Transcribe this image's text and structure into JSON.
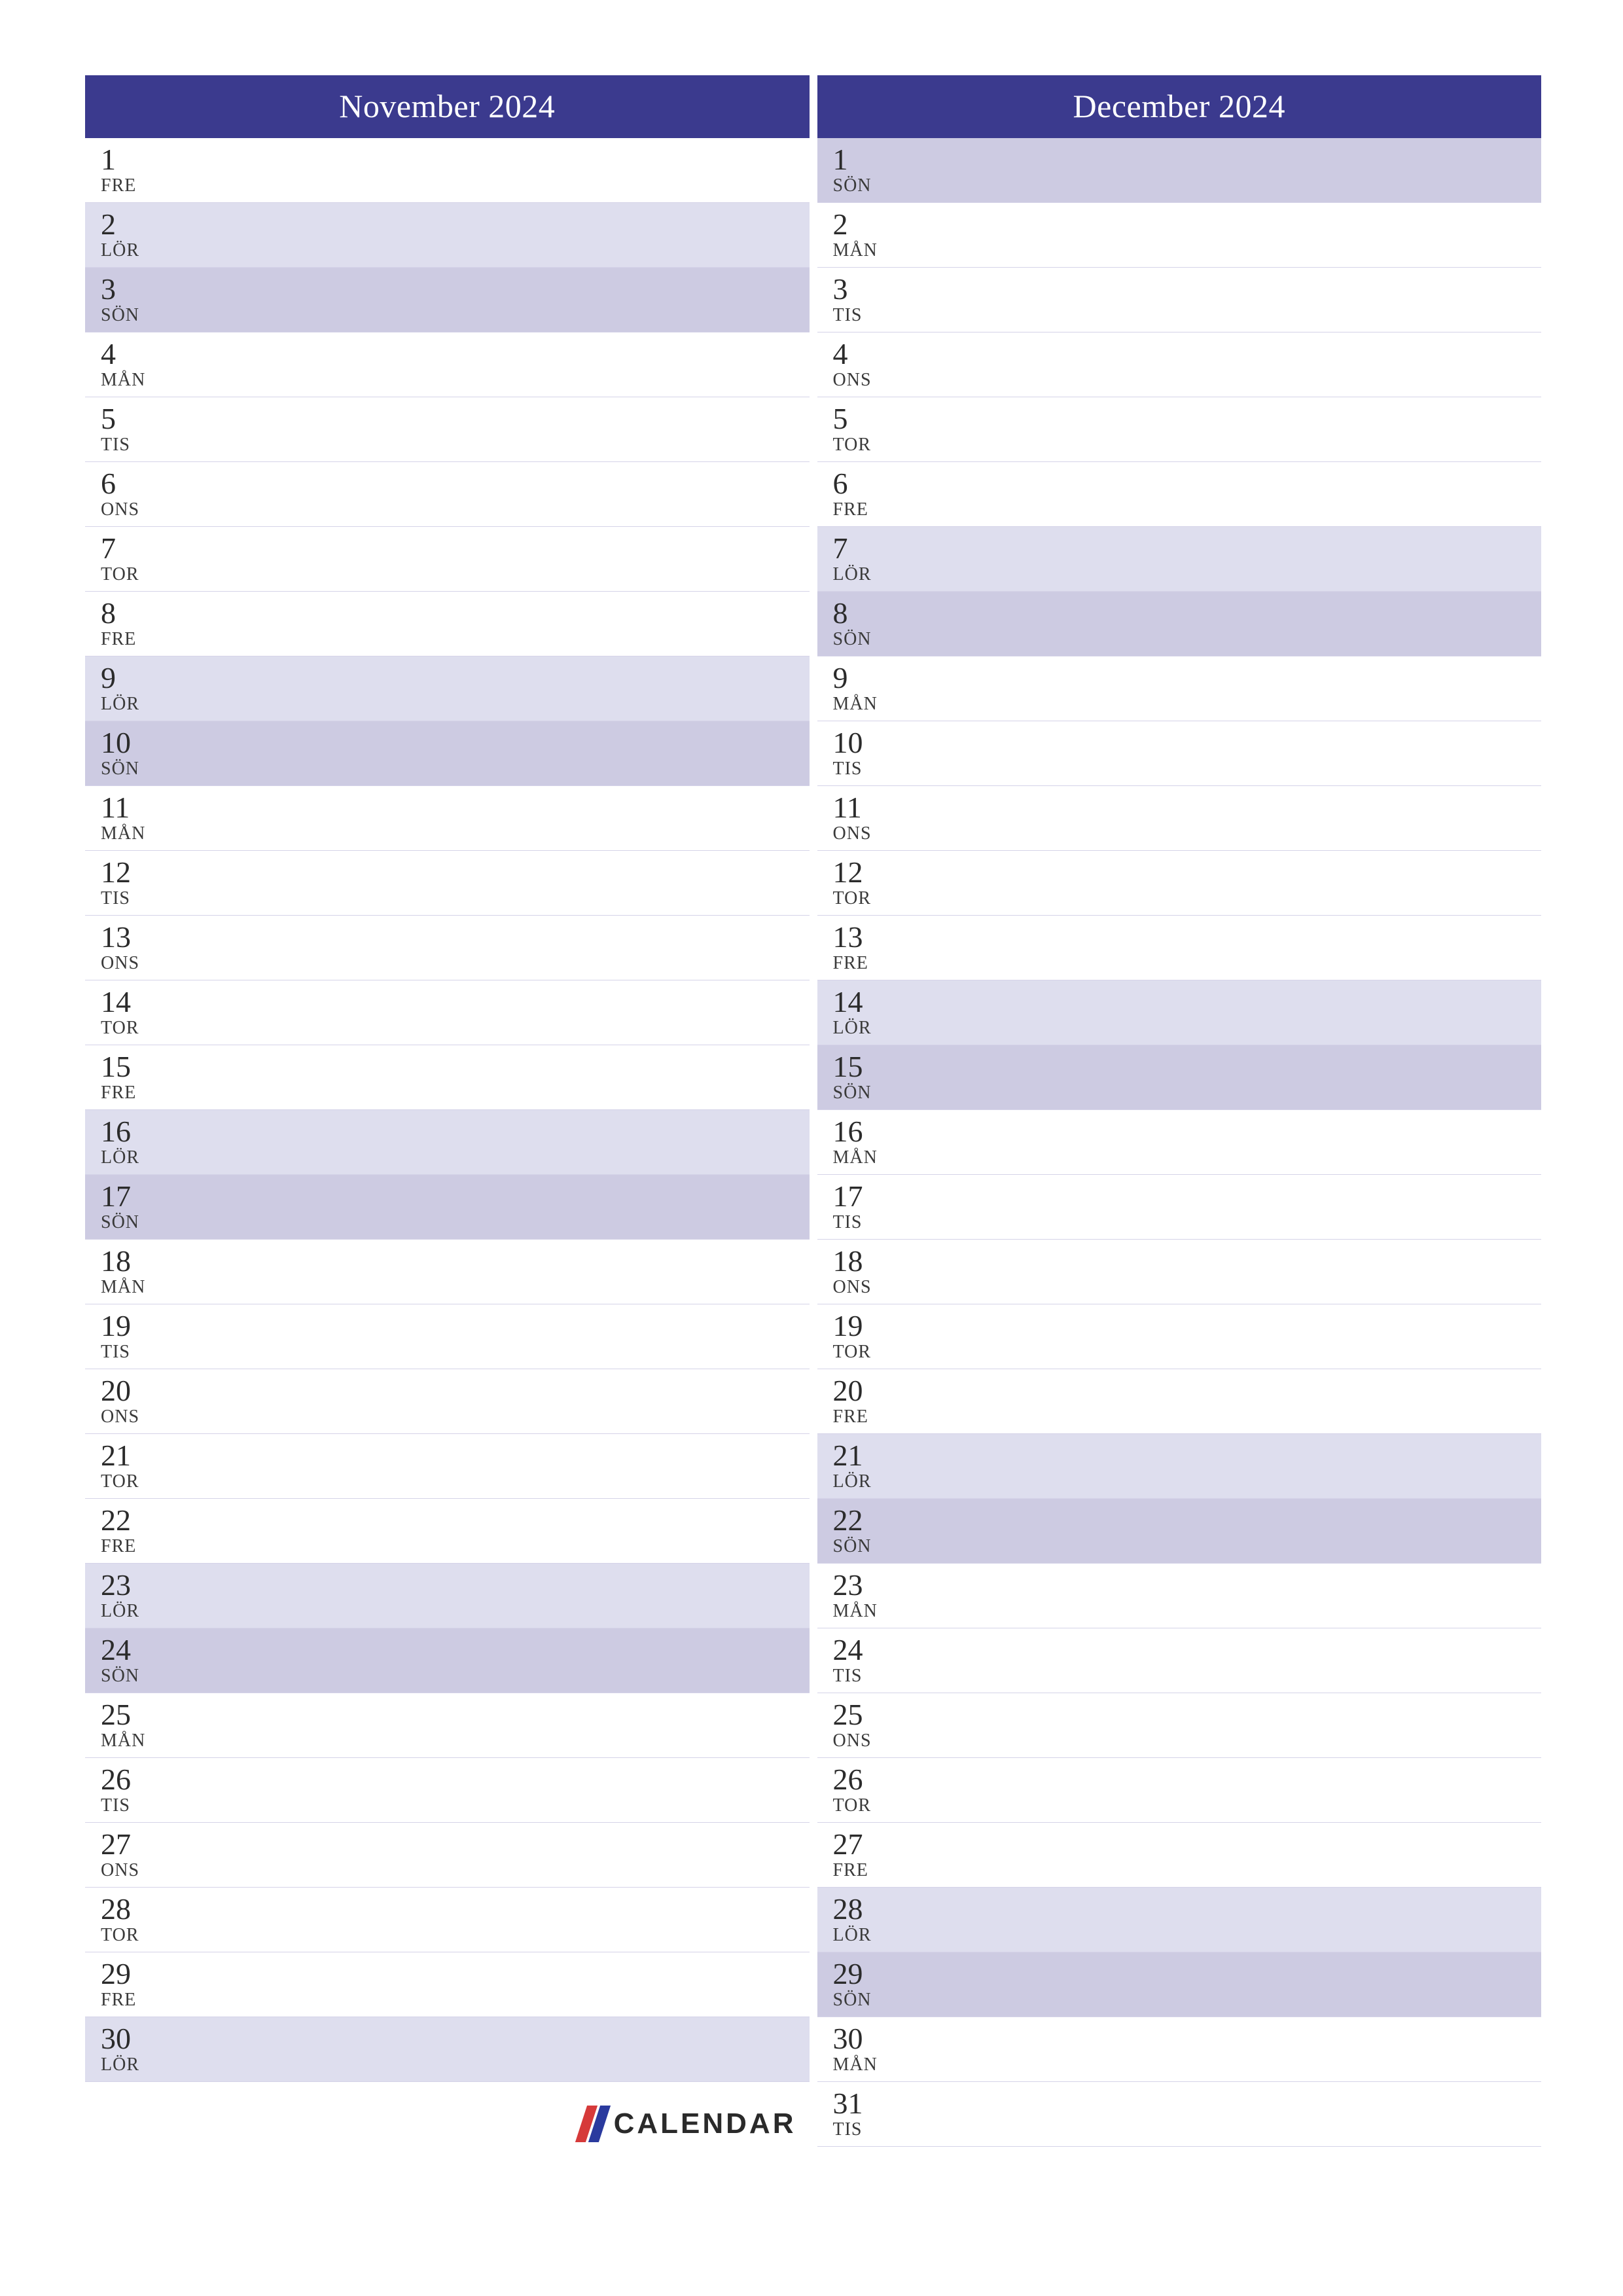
{
  "months": [
    {
      "title": "November 2024",
      "days": [
        {
          "num": "1",
          "abbr": "FRE",
          "type": "wd"
        },
        {
          "num": "2",
          "abbr": "LÖR",
          "type": "sat"
        },
        {
          "num": "3",
          "abbr": "SÖN",
          "type": "sun"
        },
        {
          "num": "4",
          "abbr": "MÅN",
          "type": "wd"
        },
        {
          "num": "5",
          "abbr": "TIS",
          "type": "wd"
        },
        {
          "num": "6",
          "abbr": "ONS",
          "type": "wd"
        },
        {
          "num": "7",
          "abbr": "TOR",
          "type": "wd"
        },
        {
          "num": "8",
          "abbr": "FRE",
          "type": "wd"
        },
        {
          "num": "9",
          "abbr": "LÖR",
          "type": "sat"
        },
        {
          "num": "10",
          "abbr": "SÖN",
          "type": "sun"
        },
        {
          "num": "11",
          "abbr": "MÅN",
          "type": "wd"
        },
        {
          "num": "12",
          "abbr": "TIS",
          "type": "wd"
        },
        {
          "num": "13",
          "abbr": "ONS",
          "type": "wd"
        },
        {
          "num": "14",
          "abbr": "TOR",
          "type": "wd"
        },
        {
          "num": "15",
          "abbr": "FRE",
          "type": "wd"
        },
        {
          "num": "16",
          "abbr": "LÖR",
          "type": "sat"
        },
        {
          "num": "17",
          "abbr": "SÖN",
          "type": "sun"
        },
        {
          "num": "18",
          "abbr": "MÅN",
          "type": "wd"
        },
        {
          "num": "19",
          "abbr": "TIS",
          "type": "wd"
        },
        {
          "num": "20",
          "abbr": "ONS",
          "type": "wd"
        },
        {
          "num": "21",
          "abbr": "TOR",
          "type": "wd"
        },
        {
          "num": "22",
          "abbr": "FRE",
          "type": "wd"
        },
        {
          "num": "23",
          "abbr": "LÖR",
          "type": "sat"
        },
        {
          "num": "24",
          "abbr": "SÖN",
          "type": "sun"
        },
        {
          "num": "25",
          "abbr": "MÅN",
          "type": "wd"
        },
        {
          "num": "26",
          "abbr": "TIS",
          "type": "wd"
        },
        {
          "num": "27",
          "abbr": "ONS",
          "type": "wd"
        },
        {
          "num": "28",
          "abbr": "TOR",
          "type": "wd"
        },
        {
          "num": "29",
          "abbr": "FRE",
          "type": "wd"
        },
        {
          "num": "30",
          "abbr": "LÖR",
          "type": "sat"
        }
      ],
      "has_logo_footer": true
    },
    {
      "title": "December 2024",
      "days": [
        {
          "num": "1",
          "abbr": "SÖN",
          "type": "sun"
        },
        {
          "num": "2",
          "abbr": "MÅN",
          "type": "wd"
        },
        {
          "num": "3",
          "abbr": "TIS",
          "type": "wd"
        },
        {
          "num": "4",
          "abbr": "ONS",
          "type": "wd"
        },
        {
          "num": "5",
          "abbr": "TOR",
          "type": "wd"
        },
        {
          "num": "6",
          "abbr": "FRE",
          "type": "wd"
        },
        {
          "num": "7",
          "abbr": "LÖR",
          "type": "sat"
        },
        {
          "num": "8",
          "abbr": "SÖN",
          "type": "sun"
        },
        {
          "num": "9",
          "abbr": "MÅN",
          "type": "wd"
        },
        {
          "num": "10",
          "abbr": "TIS",
          "type": "wd"
        },
        {
          "num": "11",
          "abbr": "ONS",
          "type": "wd"
        },
        {
          "num": "12",
          "abbr": "TOR",
          "type": "wd"
        },
        {
          "num": "13",
          "abbr": "FRE",
          "type": "wd"
        },
        {
          "num": "14",
          "abbr": "LÖR",
          "type": "sat"
        },
        {
          "num": "15",
          "abbr": "SÖN",
          "type": "sun"
        },
        {
          "num": "16",
          "abbr": "MÅN",
          "type": "wd"
        },
        {
          "num": "17",
          "abbr": "TIS",
          "type": "wd"
        },
        {
          "num": "18",
          "abbr": "ONS",
          "type": "wd"
        },
        {
          "num": "19",
          "abbr": "TOR",
          "type": "wd"
        },
        {
          "num": "20",
          "abbr": "FRE",
          "type": "wd"
        },
        {
          "num": "21",
          "abbr": "LÖR",
          "type": "sat"
        },
        {
          "num": "22",
          "abbr": "SÖN",
          "type": "sun"
        },
        {
          "num": "23",
          "abbr": "MÅN",
          "type": "wd"
        },
        {
          "num": "24",
          "abbr": "TIS",
          "type": "wd"
        },
        {
          "num": "25",
          "abbr": "ONS",
          "type": "wd"
        },
        {
          "num": "26",
          "abbr": "TOR",
          "type": "wd"
        },
        {
          "num": "27",
          "abbr": "FRE",
          "type": "wd"
        },
        {
          "num": "28",
          "abbr": "LÖR",
          "type": "sat"
        },
        {
          "num": "29",
          "abbr": "SÖN",
          "type": "sun"
        },
        {
          "num": "30",
          "abbr": "MÅN",
          "type": "wd"
        },
        {
          "num": "31",
          "abbr": "TIS",
          "type": "wd"
        }
      ],
      "has_logo_footer": false
    }
  ],
  "logo_text": "CALENDAR",
  "colors": {
    "header_bg": "#3b3a8e",
    "sat_bg": "#dedeee",
    "sun_bg": "#cdcbe2",
    "stripe_red": "#d63a3a",
    "stripe_blue": "#2a3a9e"
  }
}
